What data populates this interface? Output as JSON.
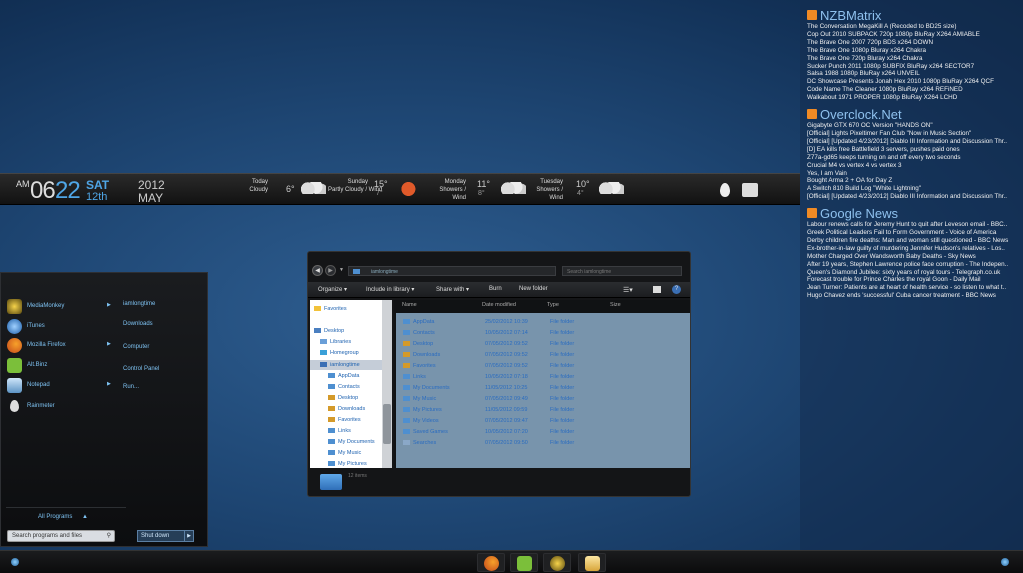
{
  "clock": {
    "ampm": "AM",
    "hour": "06",
    "minute": "22",
    "day": "SAT",
    "date": "12th",
    "year": "2012",
    "month": "MAY"
  },
  "weather": [
    {
      "day": "Today",
      "desc": "Cloudy",
      "temp": "6°"
    },
    {
      "day": "Sunday",
      "desc": "Partly Cloudy / Wind",
      "temp": "15°",
      "low": "7°"
    },
    {
      "day": "Monday",
      "desc": "Showers / Wind",
      "temp": "11°",
      "low": "8°"
    },
    {
      "day": "Tuesday",
      "desc": "Showers / Wind",
      "temp": "10°",
      "low": "4°"
    }
  ],
  "rss": [
    {
      "title": "NZBMatrix",
      "items": [
        "The Conversation MegaKill A (Recoded to BD25 size)",
        "Cop Out 2010 SUBPACK 720p 1080p BluRay X264 AMIABLE",
        "The Brave One 2007 720p BDS x264 DOWN",
        "The Brave One 1080p Bluray x264 Chakra",
        "The Brave One 720p Bluray x264 Chakra",
        "Sucker Punch 2011 1080p SUBFIX BluRay x264 SECTOR7",
        "Salsa 1988 1080p BluRay x264 UNVEIL",
        "DC Showcase Presents Jonah Hex 2010 1080p BluRay X264 QCF",
        "Code Name The Cleaner 1080p BluRay x264 REFiNED",
        "Walkabout 1971 PROPER 1080p BluRay X264 LCHD"
      ]
    },
    {
      "title": "Overclock.Net",
      "items": [
        "Gigabyte GTX 670 OC Version \"HANDS ON\"",
        "[Official] Lights Pixeltimer Fan Club \"Now in Music Section\"",
        "[Official] [Updated 4/23/2012] Diablo III Information and Discussion Thr..",
        "[D] EA kills free Battlefield 3 servers, pushes paid ones",
        "Z77a-gd65 keeps turning on and off every two seconds",
        "Crucial M4 vs vertex 4 vs vertex 3",
        "Yes, I am Vain",
        "Bought Arma 2 + OA for Day Z",
        "A Switch 810 Build Log \"White Lightning\"",
        "[Official] [Updated 4/23/2012] Diablo III Information and Discussion Thr.."
      ]
    },
    {
      "title": "Google News",
      "items": [
        "Labour renews calls for Jeremy Hunt to quit after Leveson email - BBC..",
        "Greek Political Leaders Fail to Form Government - Voice of America",
        "Derby children fire deaths: Man and woman still questioned - BBC News",
        "Ex-brother-in-law guilty of murdering Jennifer Hudson's relatives - Los..",
        "Mother Charged Over Wandsworth Baby Deaths - Sky News",
        "After 19 years, Stephen Lawrence police face corruption - The Indepen..",
        "Queen's Diamond Jubilee: sixty years of royal tours - Telegraph.co.uk",
        "Forecast trouble for Prince Charles the royal Goon - Daily Mail",
        "Jean Turner: Patients are at heart of health service - so listen to what t..",
        "Hugo Chavez ends 'successful' Cuba cancer treatment - BBC News"
      ]
    }
  ],
  "startmenu": {
    "programs": [
      "MediaMonkey",
      "iTunes",
      "Mozilla Firefox",
      "Alt.Binz",
      "Notepad",
      "Rainmeter"
    ],
    "right": [
      "iamlongtime",
      "Downloads",
      "Computer",
      "Control Panel",
      "Run..."
    ],
    "all_programs": "All Programs",
    "search_placeholder": "Search programs and files",
    "shutdown": "Shut down"
  },
  "explorer": {
    "address": "iamlongtime",
    "search_placeholder": "Search iamlongtime",
    "toolbar": [
      "Organize",
      "Include in library",
      "Share with",
      "Burn",
      "New folder"
    ],
    "nav": [
      "Favorites",
      "Desktop",
      "Libraries",
      "Homegroup",
      "iamlongtime",
      "AppData",
      "Contacts",
      "Desktop",
      "Downloads",
      "Favorites",
      "Links",
      "My Documents",
      "My Music",
      "My Pictures"
    ],
    "columns": [
      "Name",
      "Date modified",
      "Type",
      "Size"
    ],
    "files": [
      {
        "name": "AppData",
        "date": "25/02/2012 10:39",
        "type": "File folder"
      },
      {
        "name": "Contacts",
        "date": "10/05/2012 07:14",
        "type": "File folder"
      },
      {
        "name": "Desktop",
        "date": "07/05/2012 09:52",
        "type": "File folder"
      },
      {
        "name": "Downloads",
        "date": "07/05/2012 09:52",
        "type": "File folder"
      },
      {
        "name": "Favorites",
        "date": "07/05/2012 09:52",
        "type": "File folder"
      },
      {
        "name": "Links",
        "date": "10/05/2012 07:18",
        "type": "File folder"
      },
      {
        "name": "My Documents",
        "date": "11/05/2012 10:25",
        "type": "File folder"
      },
      {
        "name": "My Music",
        "date": "07/05/2012 09:49",
        "type": "File folder"
      },
      {
        "name": "My Pictures",
        "date": "11/05/2012 09:59",
        "type": "File folder"
      },
      {
        "name": "My Videos",
        "date": "07/05/2012 09:47",
        "type": "File folder"
      },
      {
        "name": "Saved Games",
        "date": "10/05/2012 07:20",
        "type": "File folder"
      },
      {
        "name": "Searches",
        "date": "07/05/2012 09:50",
        "type": "File folder"
      }
    ],
    "details": "12 items"
  },
  "taskbar": [
    "firefox",
    "altbinz",
    "mediamonkey",
    "explorer"
  ],
  "colors": {
    "accent": "#4fa6e6",
    "link": "#7ec2f2",
    "rss": "#f08a24"
  }
}
